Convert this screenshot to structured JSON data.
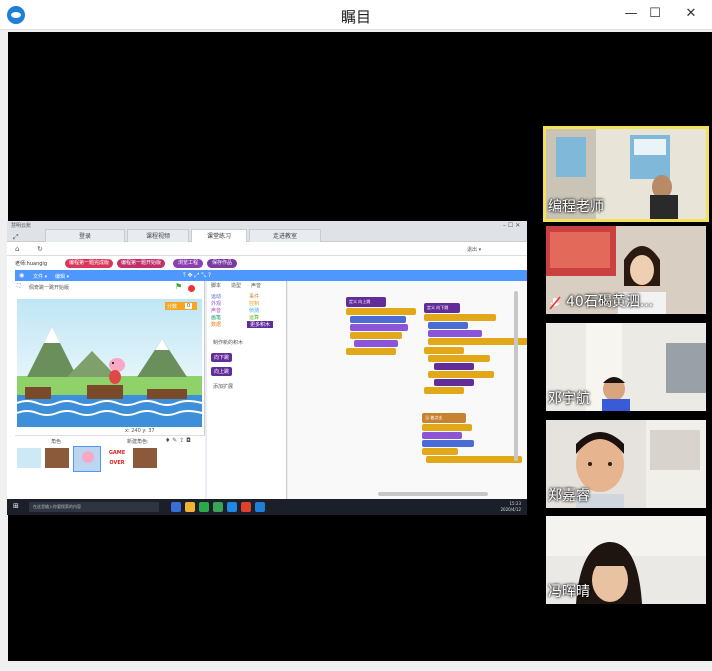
{
  "window": {
    "title": "瞩目",
    "minimize_glyph": "—",
    "maximize_glyph": "☐",
    "close_glyph": "✕"
  },
  "browser": {
    "app_label": "慧明云账",
    "tabs": [
      {
        "label": "登录",
        "active": false
      },
      {
        "label": "课程视频",
        "active": false
      },
      {
        "label": "课堂练习",
        "active": true
      },
      {
        "label": "走进教室",
        "active": false
      }
    ],
    "teacher_label": "老师:huanglg",
    "actions": [
      {
        "label": "编程第一题完成版",
        "color": "#d9365c"
      },
      {
        "label": "编程第一题开始版",
        "color": "#c0306a"
      },
      {
        "label": "浏览工程",
        "color": "#8b3fb0"
      },
      {
        "label": "保存作品",
        "color": "#7a3aa5"
      }
    ],
    "user_menu": "退出 ▾"
  },
  "scratch": {
    "menu_items": [
      "文件 ▾",
      "编辑 ▾"
    ],
    "project_title": "佩奇跳一跳开始版",
    "editor_tabs": [
      "脚本",
      "造型",
      "声音"
    ],
    "categories_left": [
      "运动",
      "外观",
      "声音",
      "画笔",
      "数据"
    ],
    "categories_right": [
      "事件",
      "控制",
      "侦测",
      "运算",
      "更多积木"
    ],
    "palette_blocks": [
      "向下跳",
      "向上跳",
      "添加扩展"
    ],
    "palette_header": "制作新的积木",
    "sprite_panel_title": "角色",
    "new_sprite_label": "新建角色:",
    "sprite_names": [
      "舞台",
      "角色1",
      "佩奇",
      "GAME OVER",
      "石头"
    ],
    "stage_coords": "x: 240  y: 37",
    "score_label": "分数",
    "score_value": "0",
    "script_hats": [
      "定义 向上跳",
      "定义 向下跳",
      "当 被点击"
    ]
  },
  "taskbar": {
    "search_placeholder": "在这里输入你要搜索的内容",
    "time": "15:23",
    "date": "2020/4/12"
  },
  "participants": [
    {
      "name": "编程老师",
      "role": "teacher",
      "muted": false
    },
    {
      "name": "40石碣黄泗...",
      "role": "student",
      "muted": true
    },
    {
      "name": "邓宇航",
      "role": "student",
      "muted": false
    },
    {
      "name": "郑嘉睿",
      "role": "student",
      "muted": false
    },
    {
      "name": "冯晖晴",
      "role": "student",
      "muted": false
    }
  ],
  "colors": {
    "active_speaker_border": "#f2e35b",
    "scratch_blue": "#4d97ff",
    "more_blocks_purple": "#632d99"
  }
}
